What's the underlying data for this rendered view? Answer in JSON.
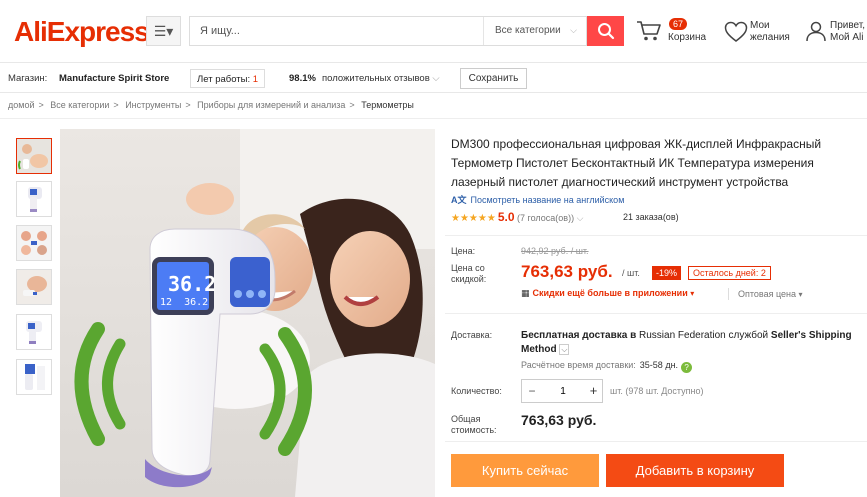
{
  "header": {
    "logo": "AliExpress",
    "search_placeholder": "Я ищу...",
    "category_select": "Все категории",
    "cart_count": "67",
    "cart_label": "Корзина",
    "wishlist_label": "Мои желания",
    "user_greeting": "Привет,",
    "user_account": "Мой Ali"
  },
  "store": {
    "store_label": "Магазин:",
    "store_name": "Manufacture Spirit Store",
    "years_label": "Лет работы:",
    "years_value": "1",
    "positive_value": "98.1%",
    "positive_label": "положительных отзывов",
    "save_label": "Сохранить"
  },
  "breadcrumb": [
    "домой",
    "Все категории",
    "Инструменты",
    "Приборы для измерений и анализа",
    "Термометры"
  ],
  "gallery": {
    "screen_reading_top": "36.2",
    "screen_reading_bottom": "36.2",
    "screen_small": "12"
  },
  "product": {
    "title": "DM300 профессиональная цифровая ЖК-дисплей Инфракрасный Термометр Пистолет Бесконтактный ИК Температура измерения лазерный пистолет диагностический инструмент устройства",
    "translate_link": "Посмотреть название на английском",
    "rating_score": "5.0",
    "rating_votes": "(7 голоса(ов))",
    "orders": "21 заказа(ов)",
    "price_label": "Цена:",
    "old_price": "942,92 руб. / шт.",
    "discount_price_label": "Цена со скидкой:",
    "new_price": "763,63 руб.",
    "unit": "/ шт.",
    "discount": "-19%",
    "days_left": "Осталось дней: 2",
    "app_promo": "Скидки ещё больше в приложении",
    "wholesale": "Оптовая цена",
    "shipping_label": "Доставка:",
    "shipping_bold1": "Бесплатная доставка в ",
    "shipping_country": "Russian Federation",
    "shipping_mid": " службой ",
    "shipping_method": "Seller's Shipping Method",
    "delivery_label": "Расчётное время доставки:",
    "delivery_value": "35-58 дн.",
    "quantity_label": "Количество:",
    "quantity_value": "1",
    "quantity_avail": "шт. (978 шт. Доступно)",
    "total_label": "Общая стоимость:",
    "total_value": "763,63 руб.",
    "buy_now": "Купить сейчас",
    "add_to_cart": "Добавить в корзину"
  },
  "colors": {
    "brand": "#e62e04",
    "search_button": "#ff4747",
    "buy_now": "#ff9a3c",
    "add_cart": "#f44b14"
  }
}
